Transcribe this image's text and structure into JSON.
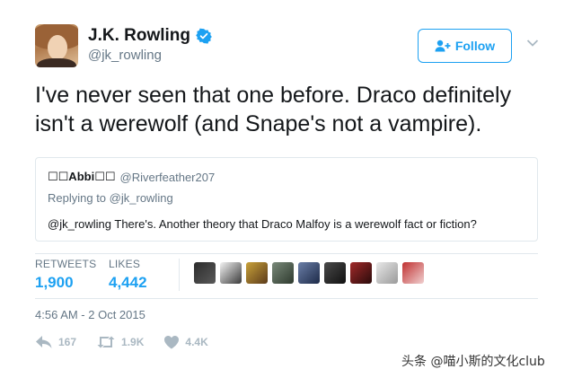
{
  "author": {
    "display_name": "J.K. Rowling",
    "handle": "@jk_rowling",
    "verified": true
  },
  "follow_button": {
    "label": "Follow"
  },
  "tweet": {
    "text_line1": "I've never seen that one before. Draco definitely",
    "text_line2": "isn't a werewolf (and Snape's not a vampire)."
  },
  "quoted_tweet": {
    "name": "☐☐Abbi☐☐",
    "handle": "@Riverfeather207",
    "replying_prefix": "Replying to",
    "replying_handle": "@jk_rowling",
    "text": "@jk_rowling There's. Another theory that Draco Malfoy is a werewolf fact or fiction?"
  },
  "stats": {
    "retweets_label": "RETWEETS",
    "retweets_value": "1,900",
    "likes_label": "LIKES",
    "likes_value": "4,442"
  },
  "timestamp": "4:56 AM - 2 Oct 2015",
  "actions": {
    "reply_count": "167",
    "retweet_count": "1.9K",
    "like_count": "4.4K"
  },
  "watermark": "头条 @喵小斯的文化club",
  "colors": {
    "accent": "#1da1f2",
    "text_primary": "#14171a",
    "text_secondary": "#657786",
    "action_gray": "#aab8c2",
    "border": "#e1e8ed"
  }
}
